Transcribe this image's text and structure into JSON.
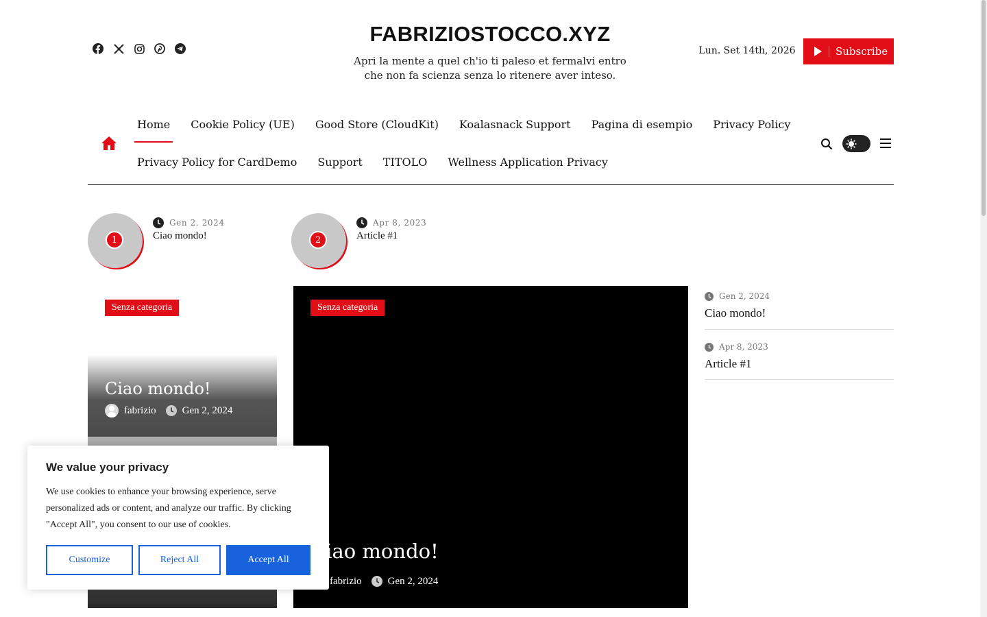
{
  "header": {
    "site_title": "FABRIZIOSTOCCO.XYZ",
    "tagline": "Apri la mente a quel ch'io ti paleso et fermalvi entro che non fa scienza senza lo ritenere aver inteso.",
    "date": "Lun. Set 14th, 2026",
    "subscribe_label": "Subscribe",
    "social_icons": [
      "facebook-icon",
      "x-icon",
      "instagram-icon",
      "pinterest-icon",
      "telegram-icon"
    ]
  },
  "nav": {
    "row1": [
      "Home",
      "Cookie Policy (UE)",
      "Good Store (CloudKit)",
      "Koalasnack Support",
      "Pagina di esempio",
      "Privacy Policy"
    ],
    "row2": [
      "Privacy Policy for CardDemo",
      "Support",
      "TITOLO",
      "Wellness Application Privacy"
    ],
    "active": "Home"
  },
  "trending": [
    {
      "num": "1",
      "date": "Gen 2, 2024",
      "title": "Ciao mondo!"
    },
    {
      "num": "2",
      "date": "Apr 8, 2023",
      "title": "Article #1"
    }
  ],
  "posts": {
    "left": {
      "category": "Senza categoria",
      "title": "Ciao mondo!",
      "author": "fabrizio",
      "date": "Gen 2, 2024"
    },
    "main": {
      "category": "Senza categoria",
      "title": "Ciao mondo!",
      "author": "fabrizio",
      "date": "Gen 2, 2024"
    }
  },
  "sidebar": [
    {
      "date": "Gen 2, 2024",
      "title": "Ciao mondo!"
    },
    {
      "date": "Apr 8, 2023",
      "title": "Article #1"
    }
  ],
  "cookie": {
    "heading": "We value your privacy",
    "body": "We use cookies to enhance your browsing experience, serve personalized ads or content, and analyze our traffic. By clicking \"Accept All\", you consent to our use of cookies.",
    "customize": "Customize",
    "reject": "Reject All",
    "accept": "Accept All"
  },
  "colors": {
    "accent": "#e20e17",
    "cookie_blue": "#1863dc"
  }
}
